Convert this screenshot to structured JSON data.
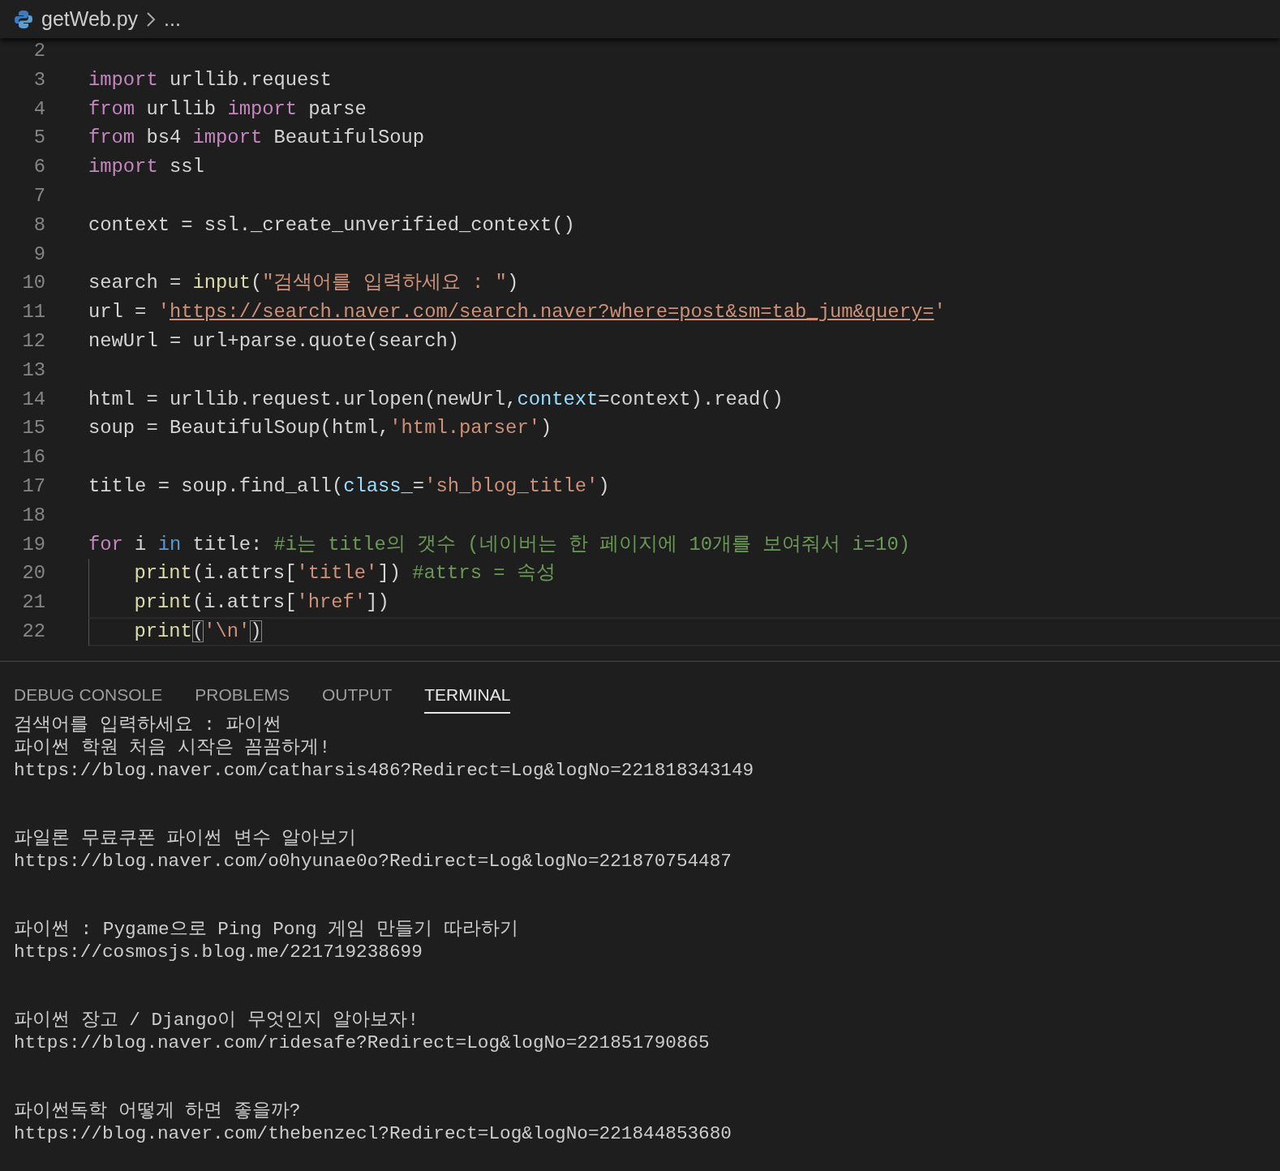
{
  "breadcrumb": {
    "file": "getWeb.py",
    "more": "..."
  },
  "editor": {
    "lines": [
      {
        "number": "2",
        "current": false
      },
      {
        "number": "3",
        "current": false,
        "tokens": [
          {
            "text": "import",
            "kind": "keyword"
          },
          {
            "text": " urllib.request",
            "kind": "plain"
          }
        ]
      },
      {
        "number": "4",
        "current": false,
        "tokens": [
          {
            "text": "from",
            "kind": "keyword"
          },
          {
            "text": " urllib ",
            "kind": "plain"
          },
          {
            "text": "import",
            "kind": "keyword"
          },
          {
            "text": " parse",
            "kind": "plain"
          }
        ]
      },
      {
        "number": "5",
        "current": false,
        "tokens": [
          {
            "text": "from",
            "kind": "keyword"
          },
          {
            "text": " bs4 ",
            "kind": "plain"
          },
          {
            "text": "import",
            "kind": "keyword"
          },
          {
            "text": " BeautifulSoup",
            "kind": "plain"
          }
        ]
      },
      {
        "number": "6",
        "current": false,
        "tokens": [
          {
            "text": "import",
            "kind": "keyword"
          },
          {
            "text": " ssl",
            "kind": "plain"
          }
        ]
      },
      {
        "number": "7",
        "current": false
      },
      {
        "number": "8",
        "current": false,
        "tokens": [
          {
            "text": "context = ssl._create_unverified_context()",
            "kind": "plain"
          }
        ]
      },
      {
        "number": "9",
        "current": false
      },
      {
        "number": "10",
        "current": false,
        "tokens": [
          {
            "text": "search = ",
            "kind": "plain"
          },
          {
            "text": "input",
            "kind": "function"
          },
          {
            "text": "(",
            "kind": "plain"
          },
          {
            "text": "\"검색어를 입력하세요 : \"",
            "kind": "string"
          },
          {
            "text": ")",
            "kind": "plain"
          }
        ]
      },
      {
        "number": "11",
        "current": false,
        "tokens": [
          {
            "text": "url = ",
            "kind": "plain"
          },
          {
            "text": "'",
            "kind": "string"
          },
          {
            "text": "https://search.naver.com/search.naver?where=post&sm=tab_jum&query=",
            "kind": "link"
          },
          {
            "text": "'",
            "kind": "string"
          }
        ]
      },
      {
        "number": "12",
        "current": false,
        "tokens": [
          {
            "text": "newUrl = url+parse.quote(search)",
            "kind": "plain"
          }
        ]
      },
      {
        "number": "13",
        "current": false
      },
      {
        "number": "14",
        "current": false,
        "tokens": [
          {
            "text": "html = urllib.request.urlopen(newUrl,",
            "kind": "plain"
          },
          {
            "text": "context",
            "kind": "param"
          },
          {
            "text": "=context).read()",
            "kind": "plain"
          }
        ]
      },
      {
        "number": "15",
        "current": false,
        "tokens": [
          {
            "text": "soup = BeautifulSoup(html,",
            "kind": "plain"
          },
          {
            "text": "'html.parser'",
            "kind": "string"
          },
          {
            "text": ")",
            "kind": "plain"
          }
        ]
      },
      {
        "number": "16",
        "current": false
      },
      {
        "number": "17",
        "current": false,
        "tokens": [
          {
            "text": "title = soup.find_all(",
            "kind": "plain"
          },
          {
            "text": "class_",
            "kind": "param"
          },
          {
            "text": "=",
            "kind": "plain"
          },
          {
            "text": "'sh_blog_title'",
            "kind": "string"
          },
          {
            "text": ")",
            "kind": "plain"
          }
        ]
      },
      {
        "number": "18",
        "current": false
      },
      {
        "number": "19",
        "current": false,
        "tokens": [
          {
            "text": "for",
            "kind": "keyword"
          },
          {
            "text": " i ",
            "kind": "plain"
          },
          {
            "text": "in",
            "kind": "operator"
          },
          {
            "text": " title: ",
            "kind": "plain"
          },
          {
            "text": "#i는 title의 갯수 (네이버는 한 페이지에 10개를 보여줘서 i=10)",
            "kind": "comment"
          }
        ],
        "children": [
          {
            "number": "20",
            "current": false,
            "tokens": [
              {
                "text": "print",
                "kind": "function"
              },
              {
                "text": "(i.attrs[",
                "kind": "plain"
              },
              {
                "text": "'title'",
                "kind": "string"
              },
              {
                "text": "]) ",
                "kind": "plain"
              },
              {
                "text": "#attrs = 속성",
                "kind": "comment"
              }
            ]
          },
          {
            "number": "21",
            "current": false,
            "tokens": [
              {
                "text": "print",
                "kind": "function"
              },
              {
                "text": "(i.attrs[",
                "kind": "plain"
              },
              {
                "text": "'href'",
                "kind": "string"
              },
              {
                "text": "])",
                "kind": "plain"
              }
            ]
          },
          {
            "number": "22",
            "current": true,
            "tokens": [
              {
                "text": "print",
                "kind": "function"
              },
              {
                "text": "(",
                "kind": "bracket"
              },
              {
                "text": "'\\n'",
                "kind": "string"
              },
              {
                "text": ")",
                "kind": "bracket"
              }
            ]
          }
        ]
      }
    ]
  },
  "panel": {
    "tabs": [
      {
        "label": "DEBUG CONSOLE",
        "selected": false
      },
      {
        "label": "PROBLEMS",
        "selected": false
      },
      {
        "label": "OUTPUT",
        "selected": false
      },
      {
        "label": "TERMINAL",
        "selected": true
      }
    ],
    "terminal": {
      "prompt": "검색어를 입력하세요 : 파이썬",
      "results": [
        {
          "title": "파이썬 학원 처음 시작은 꼼꼼하게!",
          "url": "https://blog.naver.com/catharsis486?Redirect=Log&logNo=221818343149"
        },
        {
          "title": "파일론 무료쿠폰 파이썬 변수 알아보기",
          "url": "https://blog.naver.com/o0hyunae0o?Redirect=Log&logNo=221870754487"
        },
        {
          "title": "파이썬 : Pygame으로 Ping Pong 게임 만들기 따라하기",
          "url": "https://cosmosjs.blog.me/221719238699"
        },
        {
          "title": "파이썬 장고 / Django이 무엇인지 알아보자!",
          "url": "https://blog.naver.com/ridesafe?Redirect=Log&logNo=221851790865"
        },
        {
          "title": "파이썬독학 어떻게 하면 좋을까?",
          "url": "https://blog.naver.com/thebenzecl?Redirect=Log&logNo=221844853680"
        }
      ]
    }
  }
}
